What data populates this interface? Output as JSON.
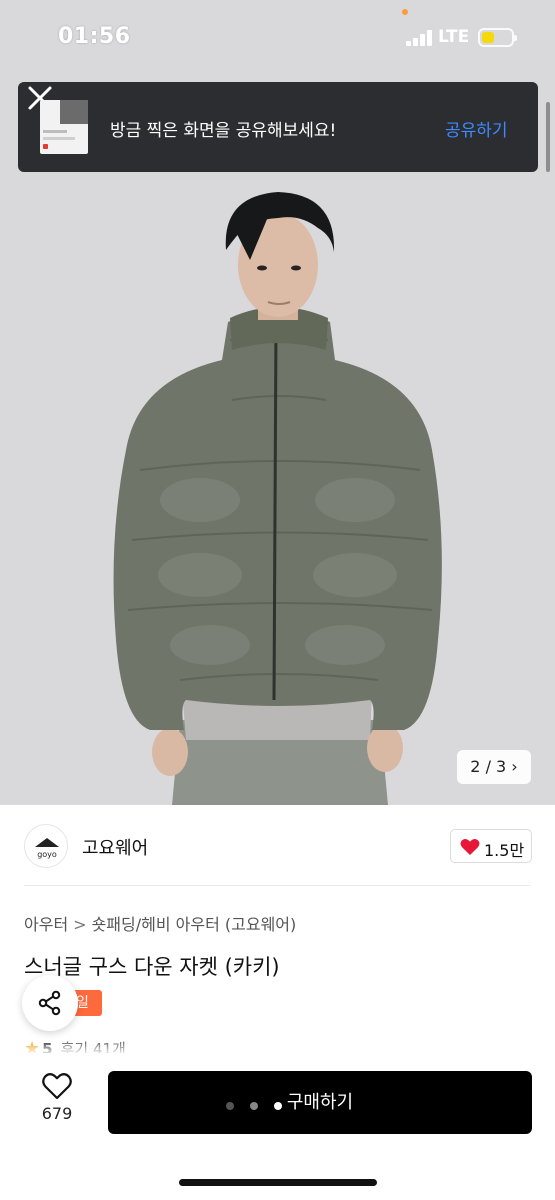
{
  "status_bar": {
    "time": "01:56",
    "network": "LTE"
  },
  "share_toast": {
    "message": "방금 찍은 화면을 공유해보세요!",
    "action_label": "공유하기",
    "close_icon": "close-icon"
  },
  "gallery": {
    "pager_text": "2 / 3 ›",
    "current": 2,
    "total": 3
  },
  "brand": {
    "logo_text": "goyo",
    "name": "고요웨어",
    "like_count": "1.5만"
  },
  "product": {
    "breadcrumb": [
      "아우터",
      "숏패딩/헤비 아우터 (고요웨어)"
    ],
    "breadcrumb_separator": ">",
    "title": "스너글 구스 다운 자켓 (카키)",
    "sale_badge": "일",
    "rating": "5",
    "reviews": "후기 41개"
  },
  "bottom_bar": {
    "wish_count": "679",
    "buy_label": "구매하기"
  },
  "colors": {
    "accent_blue": "#3d8bff",
    "sale_orange": "#ff6a3d",
    "heart_red": "#e8173a",
    "buy_button": "#000000"
  }
}
